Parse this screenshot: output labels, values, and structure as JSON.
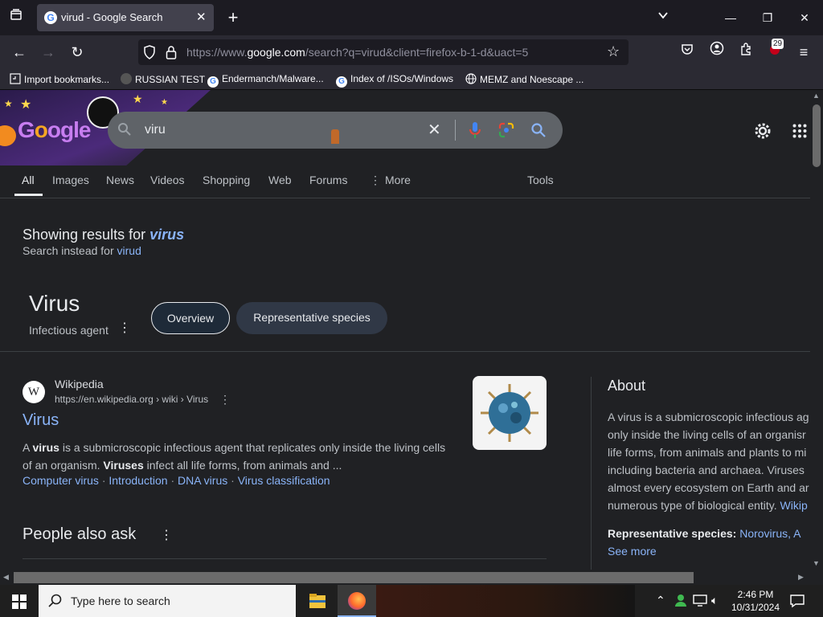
{
  "browser": {
    "tab_title": "virud - Google Search",
    "url_prefix": "https://www.",
    "url_domain": "google.com",
    "url_rest": "/search?q=virud&client=firefox-b-1-d&uact=5",
    "notification_badge": "29",
    "bookmarks": [
      "Import bookmarks...",
      "RUSSIAN TEST",
      "Endermanch/Malware...",
      "Index of /ISOs/Windows",
      "MEMZ and Noescape ..."
    ]
  },
  "search": {
    "query": "viru",
    "tabs": [
      "All",
      "Images",
      "News",
      "Videos",
      "Shopping",
      "Web",
      "Forums",
      "More"
    ],
    "tools_label": "Tools",
    "showing_prefix": "Showing results for",
    "showing_term": "virus",
    "instead_prefix": "Search instead for",
    "instead_term": "virud"
  },
  "entity": {
    "title": "Virus",
    "subtitle": "Infectious agent",
    "chips": [
      "Overview",
      "Representative species"
    ]
  },
  "result": {
    "source_name": "Wikipedia",
    "source_url": "https://en.wikipedia.org › wiki › Virus",
    "title": "Virus",
    "snippet_line1_a": "A ",
    "snippet_line1_b": "virus",
    "snippet_line1_c": " is a submicroscopic infectious agent that replicates only inside the living cells",
    "snippet_line2_a": "of an organism. ",
    "snippet_line2_b": "Viruses",
    "snippet_line2_c": " infect all life forms, from animals and ...",
    "sitelinks": [
      "Computer virus",
      "Introduction",
      "DNA virus",
      "Virus classification"
    ]
  },
  "people_also_ask": "People also ask",
  "about": {
    "heading": "About",
    "lines": [
      "A virus is a submicroscopic infectious ag",
      "only inside the living cells of an organisr",
      "life forms, from animals and plants to mi",
      "including bacteria and archaea. Viruses",
      "almost every ecosystem on Earth and ar",
      "numerous type of biological entity."
    ],
    "wiki_link": "Wikip",
    "rep_label": "Representative species:",
    "rep_value": "Norovirus, A",
    "see_more": "See more"
  },
  "taskbar": {
    "search_placeholder": "Type here to search",
    "time": "2:46 PM",
    "date": "10/31/2024"
  },
  "colors": {
    "link": "#8ab4f8",
    "page_bg": "#202124",
    "chrome_bg": "#2b2a33"
  }
}
